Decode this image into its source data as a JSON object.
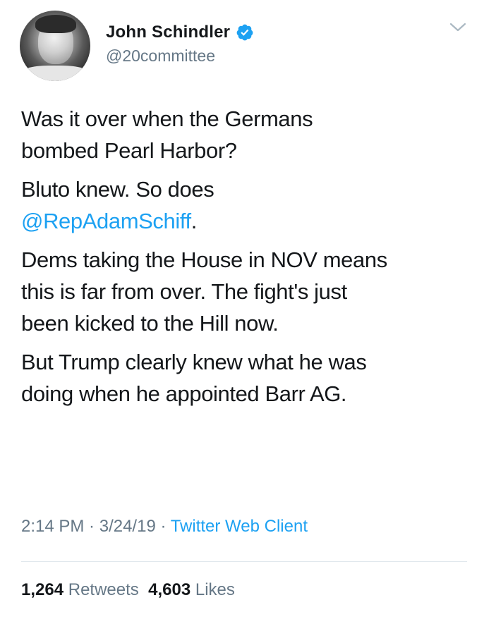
{
  "user": {
    "name": "John Schindler",
    "handle": "@20committee"
  },
  "tweet": {
    "para1_line1": "Was it over when the Germans",
    "para1_line2": "bombed Pearl Harbor?",
    "para2_line1": "Bluto knew. So does",
    "para2_mention": "@RepAdamSchiff",
    "para2_end": ".",
    "para3_line1": "Dems taking the House in NOV means",
    "para3_line2": "this is far from over. The fight's just",
    "para3_line3": "been kicked to the Hill now.",
    "para4_line1": "But Trump clearly knew what he was",
    "para4_line2": "doing when he appointed Barr AG."
  },
  "meta": {
    "time": "2:14 PM",
    "sep1": " · ",
    "date": "3/24/19",
    "sep2": " · ",
    "client": "Twitter Web Client"
  },
  "stats": {
    "retweets_count": "1,264",
    "retweets_label": "Retweets",
    "likes_count": "4,603",
    "likes_label": "Likes"
  },
  "colors": {
    "link": "#1da1f2",
    "secondary_text": "#657786",
    "primary_text": "#14171a",
    "divider": "#e1e8ed"
  },
  "icons": {
    "verified": "verified-badge-icon",
    "chevron": "chevron-down-icon"
  }
}
